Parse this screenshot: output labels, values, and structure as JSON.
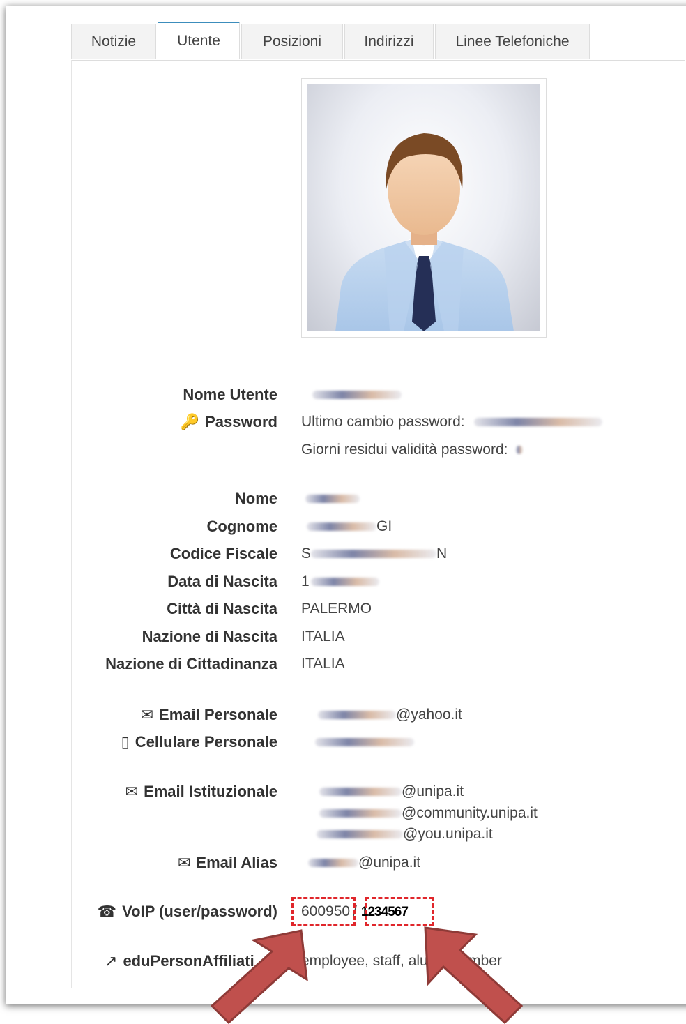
{
  "tabs": [
    {
      "label": "Notizie",
      "active": false
    },
    {
      "label": "Utente",
      "active": true
    },
    {
      "label": "Posizioni",
      "active": false
    },
    {
      "label": "Indirizzi",
      "active": false
    },
    {
      "label": "Linee Telefoniche",
      "active": false
    }
  ],
  "fields": {
    "username_label": "Nome Utente",
    "password_label": "Password",
    "password_last_change": "Ultimo cambio password:",
    "password_days_left": "Giorni residui validità password:",
    "nome_label": "Nome",
    "cognome_label": "Cognome",
    "cognome_tail": "GI",
    "cf_label": "Codice Fiscale",
    "cf_head": "S",
    "cf_tail": "N",
    "birthdate_label": "Data di Nascita",
    "birthdate_head": "1",
    "birthcity_label": "Città di Nascita",
    "birthcity_value": "PALERMO",
    "birthnation_label": "Nazione di Nascita",
    "birthnation_value": "ITALIA",
    "citizenship_label": "Nazione di Cittadinanza",
    "citizenship_value": "ITALIA",
    "email_personal_label": "Email Personale",
    "email_personal_domain": "@yahoo.it",
    "mobile_label": "Cellulare Personale",
    "email_inst_label": "Email Istituzionale",
    "email_inst_1": "@unipa.it",
    "email_inst_2": "@community.unipa.it",
    "email_inst_3": "@you.unipa.it",
    "email_alias_label": "Email Alias",
    "email_alias_domain": "@unipa.it",
    "voip_label": "VoIP (user/password)",
    "voip_user": "600950",
    "voip_sep": "/",
    "voip_password": "1234567",
    "affiliation_label": "eduPersonAffiliati",
    "affiliation_value": "employee, staff, alum, member"
  },
  "colors": {
    "accent": "#3c8dbc",
    "highlight": "#e0262b",
    "arrow": "#c0504d"
  },
  "icons": {
    "password": "key-icon",
    "email": "envelope-outline-icon",
    "mobile": "mobile-phone-icon",
    "email_inst": "envelope-solid-icon",
    "voip": "phone-square-icon",
    "affiliation": "external-link-icon"
  }
}
